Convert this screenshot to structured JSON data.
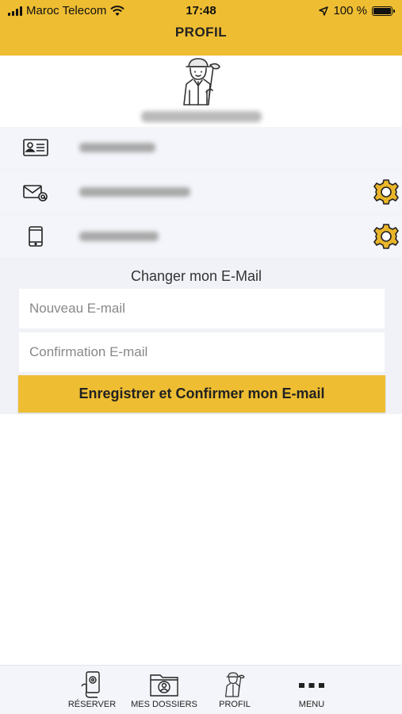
{
  "status_bar": {
    "carrier": "Maroc Telecom",
    "time": "17:48",
    "battery": "100 %",
    "icons": [
      "signal-icon",
      "wifi-icon",
      "location-arrow-icon",
      "battery-icon"
    ]
  },
  "header": {
    "title": "PROFIL"
  },
  "profile": {
    "avatar_icon": "golfer-avatar-icon",
    "name_redacted": true
  },
  "info_rows": [
    {
      "icon": "id-card-icon",
      "redacted": true,
      "has_settings": false
    },
    {
      "icon": "email-icon",
      "redacted": true,
      "has_settings": true
    },
    {
      "icon": "phone-icon",
      "redacted": true,
      "has_settings": true
    }
  ],
  "change_email": {
    "title": "Changer mon E-Mail",
    "new_email": {
      "value": "",
      "placeholder": "Nouveau E-mail"
    },
    "confirm_email": {
      "value": "",
      "placeholder": "Confirmation E-mail"
    },
    "submit_label": "Enregistrer et Confirmer mon E-mail"
  },
  "tabbar": {
    "items": [
      {
        "label": "RÉSERVER",
        "icon": "phone-booking-icon"
      },
      {
        "label": "MES DOSSIERS",
        "icon": "folder-user-icon"
      },
      {
        "label": "PROFIL",
        "icon": "golfer-avatar-icon"
      },
      {
        "label": "MENU",
        "icon": "more-dots-icon"
      }
    ]
  },
  "colors": {
    "accent": "#eebd32",
    "row_background": "#f3f5fa",
    "gear": "#e9b52a"
  }
}
